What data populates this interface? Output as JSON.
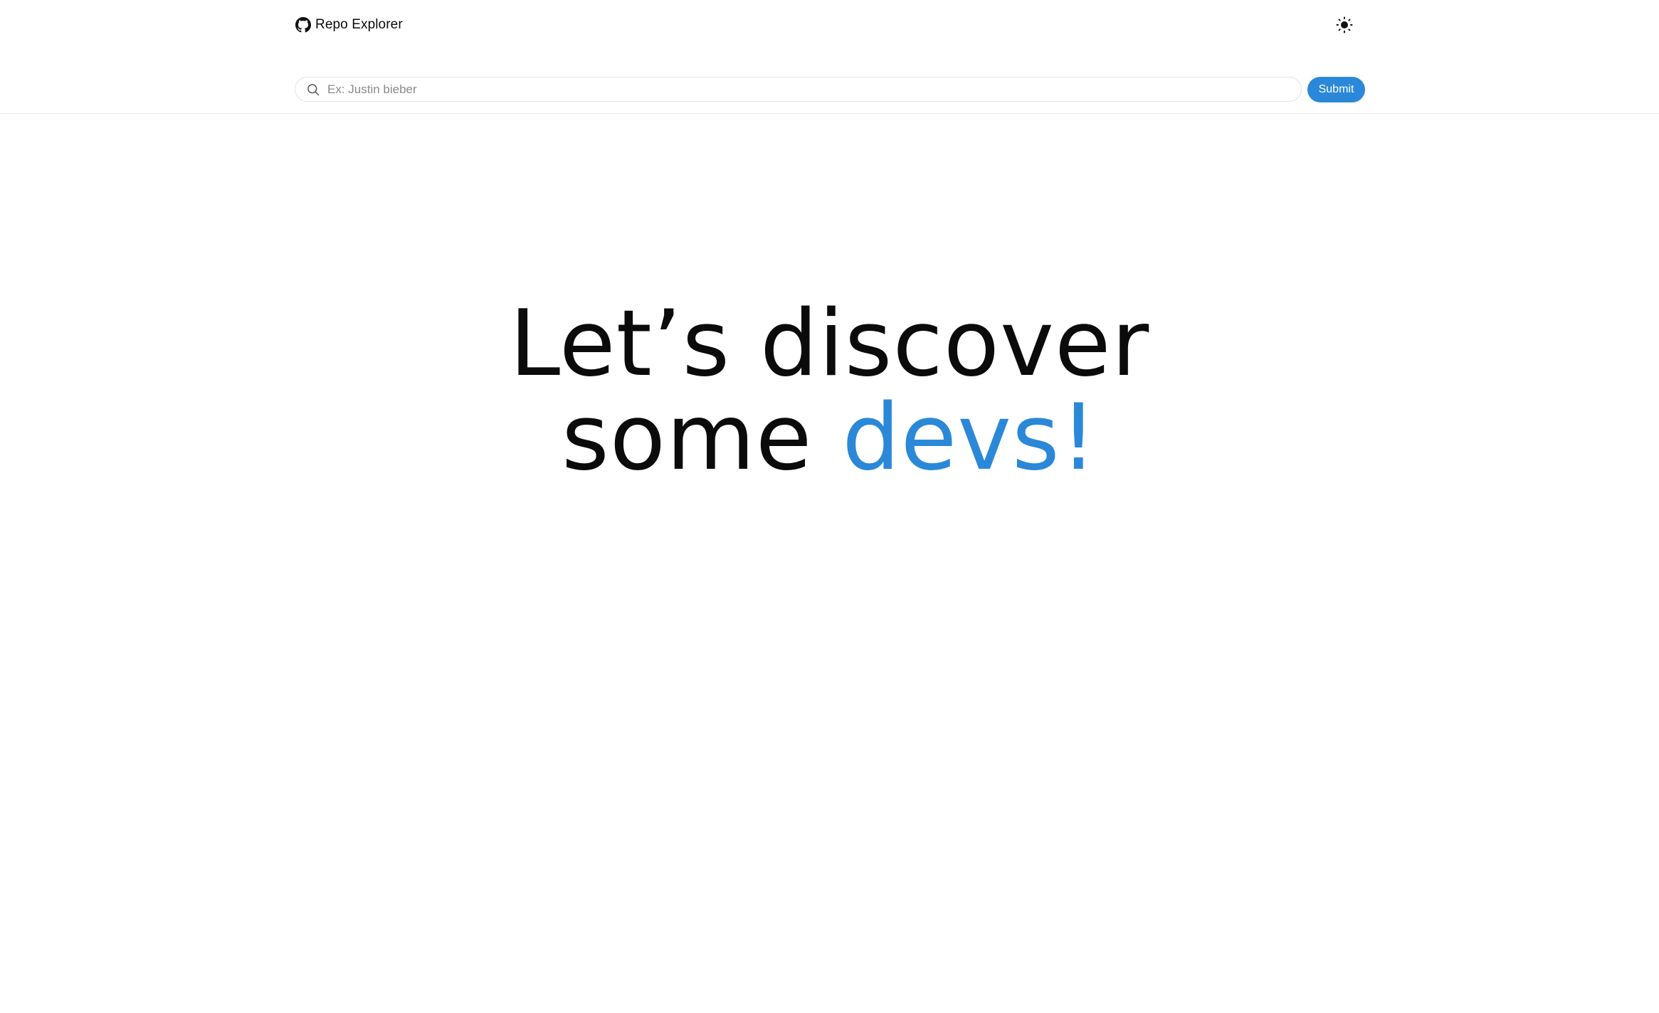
{
  "header": {
    "app_name": "Repo Explorer",
    "logo_icon": "github-icon",
    "theme_toggle_icon": "sun-icon"
  },
  "search": {
    "placeholder": "Ex: Justin bieber",
    "value": "",
    "icon": "search-icon",
    "submit_label": "Submit"
  },
  "hero": {
    "line1": "Let’s discover",
    "line2_plain": "some ",
    "line2_accent": "devs!"
  },
  "colors": {
    "accent": "#2b88d8",
    "text": "#0b0b0b",
    "background": "#ffffff",
    "placeholder": "#8a8a8a",
    "border": "#e3e3e3"
  }
}
